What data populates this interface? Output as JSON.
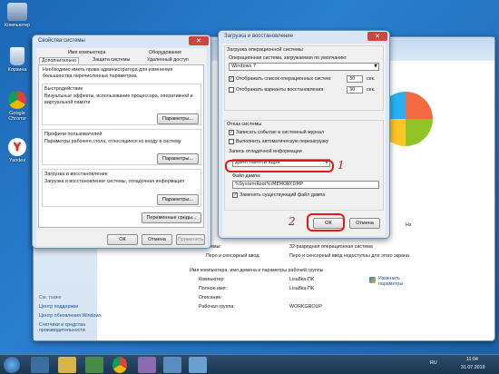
{
  "desktop": {
    "icons": [
      "Компьютер",
      "Корзина",
      "Google Chrome",
      "Yandex"
    ]
  },
  "sysprops": {
    "title": "Свойства системы",
    "tabs_top": [
      "Имя компьютера",
      "Оборудование"
    ],
    "tabs_bottom": [
      "Дополнительно",
      "Защита системы",
      "Удаленный доступ"
    ],
    "admin_note": "Необходимо иметь права администратора для изменения большинства перечисленных параметров.",
    "perf": {
      "title": "Быстродействие",
      "desc": "Визуальные эффекты, использование процессора, оперативной и виртуальной памяти",
      "button": "Параметры..."
    },
    "profiles": {
      "title": "Профили пользователей",
      "desc": "Параметры рабочего стола, относящиеся ко входу в систему",
      "button": "Параметры..."
    },
    "startup": {
      "title": "Загрузка и восстановление",
      "desc": "Загрузка и восстановление системы, отладочная информация",
      "button": "Параметры..."
    },
    "env_button": "Переменные среды...",
    "ok": "ОК",
    "cancel": "Отмена",
    "apply": "Применить"
  },
  "startup_dialog": {
    "title": "Загрузка и восстановление",
    "group1": "Загрузка операционной системы",
    "default_os_label": "Операционная система, загружаемая по умолчанию:",
    "default_os_value": "Windows 7",
    "show_list_label": "Отображать список операционных систем:",
    "show_list_secs": "30",
    "show_recovery_label": "Отображать варианты восстановления:",
    "show_recovery_secs": "30",
    "sec_label": "сек.",
    "group2": "Отказ системы",
    "log_event": "Записать событие в системный журнал",
    "auto_reboot": "Выполнить автоматическую перезагрузку",
    "debug_label": "Запись отладочной информации",
    "debug_value": "Дамп памяти ядра",
    "dump_file_label": "Файл дампа:",
    "dump_file_value": "%SystemRoot%\\MEMORY.DMP",
    "overwrite": "Заменять существующий файл дампа",
    "ok": "ОК",
    "cancel": "Отмена",
    "mark1": "1",
    "mark2": "2"
  },
  "control_panel": {
    "see_also": "См. также",
    "links": [
      "Центр поддержки",
      "Центр обновления Windows",
      "Счетчики и средства производительности"
    ],
    "rows": [
      {
        "key": "стемы:",
        "val": "32-разрядная операционная система"
      },
      {
        "key": "Перо и сенсорный ввод:",
        "val": "Перо и сенсорный ввод недоступны для этого экрана"
      }
    ],
    "section": "Имя компьютера, имя домена и параметры рабочей группы",
    "rows2": [
      {
        "key": "Компьютер:",
        "val": "Lisa8ka-ПК"
      },
      {
        "key": "Полное имя:",
        "val": "Lisa8ka-ПК"
      },
      {
        "key": "Описание:",
        "val": ""
      },
      {
        "key": "Рабочая группа:",
        "val": "WORKGROUP"
      }
    ],
    "change_link": "Изменить параметры",
    "ghz": "Hz"
  },
  "taskbar": {
    "time": "11:04",
    "date": "31.07.2019",
    "lang": "RU"
  },
  "watermark": "user-life.com"
}
